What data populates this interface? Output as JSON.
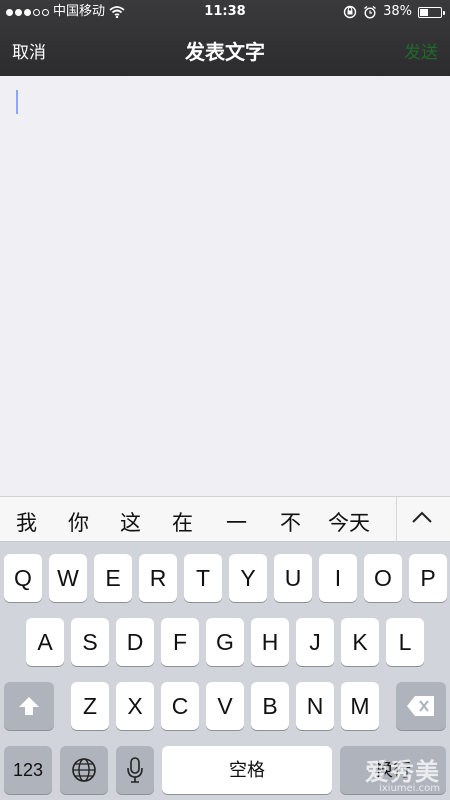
{
  "status_bar": {
    "carrier": "中国移动",
    "time": "11:38",
    "battery_percent": 38,
    "battery_label": "38%",
    "signal_filled": 3,
    "signal_total": 5
  },
  "nav": {
    "cancel_label": "取消",
    "title": "发表文字",
    "send_label": "发送"
  },
  "editor": {
    "value": ""
  },
  "candidates": [
    "我",
    "你",
    "这",
    "在",
    "一",
    "不",
    "今天"
  ],
  "keyboard": {
    "row1": [
      "Q",
      "W",
      "E",
      "R",
      "T",
      "Y",
      "U",
      "I",
      "O",
      "P"
    ],
    "row2": [
      "A",
      "S",
      "D",
      "F",
      "G",
      "H",
      "J",
      "K",
      "L"
    ],
    "row3": [
      "Z",
      "X",
      "C",
      "V",
      "B",
      "N",
      "M"
    ],
    "numbers_label": "123",
    "space_label": "空格",
    "return_label": "换行"
  },
  "watermark": {
    "text": "爱秀美",
    "url": "ixiumei.com"
  },
  "colors": {
    "send": "#1f6b2a",
    "caret": "#8aa7ff"
  }
}
